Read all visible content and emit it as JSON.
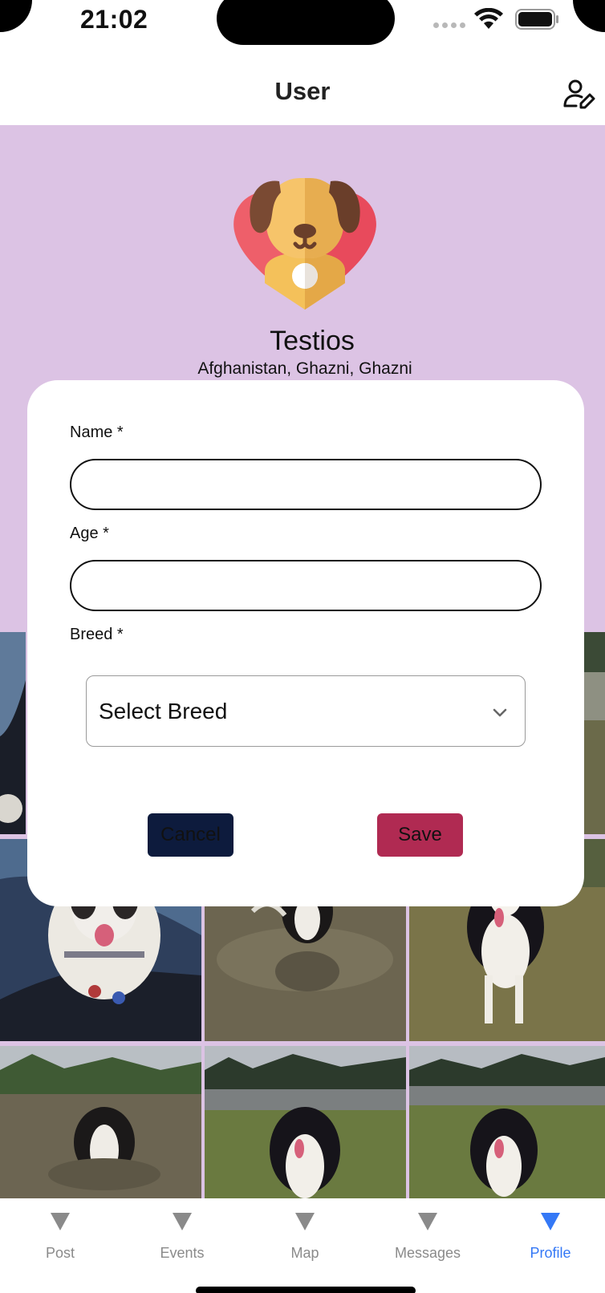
{
  "status_bar": {
    "time": "21:02"
  },
  "header": {
    "title": "User",
    "edit_icon": "person-edit-icon"
  },
  "profile": {
    "name": "Testios",
    "location": "Afghanistan, Ghazni, Ghazni",
    "avatar_icon": "dog-heart-avatar-icon"
  },
  "form": {
    "name_label": "Name *",
    "name_value": "",
    "age_label": "Age *",
    "age_value": "",
    "breed_label": "Breed *",
    "breed_value": "Select Breed",
    "cancel_label": "Cancel",
    "save_label": "Save"
  },
  "tabs": [
    {
      "label": "Post",
      "icon": "triangle-down-icon",
      "active": false
    },
    {
      "label": "Events",
      "icon": "triangle-down-icon",
      "active": false
    },
    {
      "label": "Map",
      "icon": "triangle-down-icon",
      "active": false
    },
    {
      "label": "Messages",
      "icon": "triangle-down-icon",
      "active": false
    },
    {
      "label": "Profile",
      "icon": "triangle-down-icon",
      "active": true
    }
  ],
  "colors": {
    "profile_background": "#dcc3e4",
    "cancel_button": "#0d1b3d",
    "save_button": "#b02a52",
    "active_tab": "#3478f6",
    "inactive_tab": "#8a8a8a"
  }
}
